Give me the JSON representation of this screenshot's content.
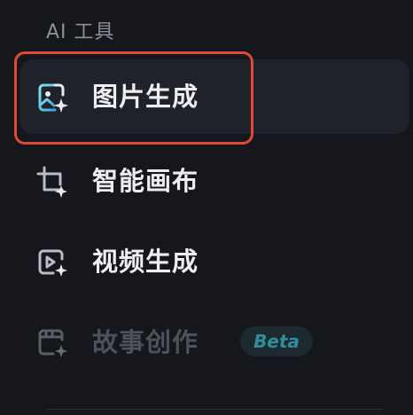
{
  "section": {
    "title": "AI 工具"
  },
  "nav": {
    "items": [
      {
        "label": "图片生成",
        "icon": "image-sparkle-icon",
        "active": true
      },
      {
        "label": "智能画布",
        "icon": "crop-sparkle-icon",
        "active": false
      },
      {
        "label": "视频生成",
        "icon": "video-sparkle-icon",
        "active": false
      },
      {
        "label": "故事创作",
        "icon": "storyboard-sparkle-icon",
        "active": false,
        "disabled": true,
        "badge": "Beta"
      }
    ]
  },
  "colors": {
    "background": "#15171c",
    "active_bg": "#1f2229",
    "highlight_border": "#e04a34",
    "accent": "#5ad1e6",
    "badge_text": "#2f8e9c"
  }
}
